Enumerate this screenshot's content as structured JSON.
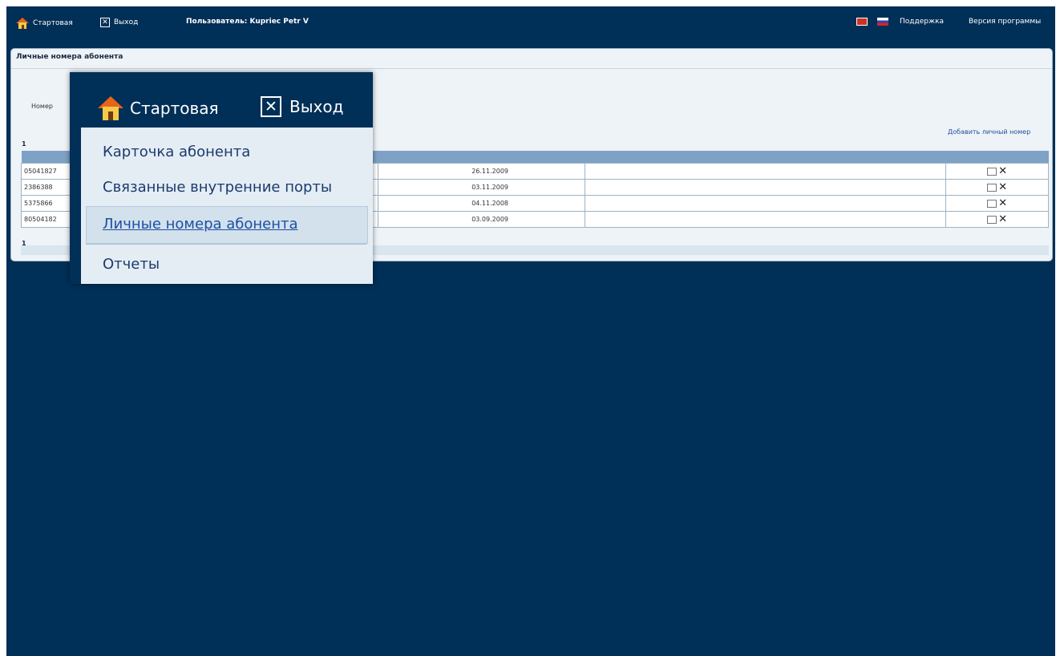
{
  "topbar": {
    "home_label": "Стартовая",
    "exit_label": "Выход",
    "user_label": "Пользователь: Kupriec Petr V",
    "support_label": "Поддержка",
    "version_label": "Версия программы"
  },
  "panel": {
    "title": "Личные номера абонента",
    "number_label": "Номер",
    "add_link": "Добавить личный номер",
    "pager_top": "1",
    "pager_bottom": "1"
  },
  "table": {
    "rows": [
      {
        "number": "05041827",
        "date": "26.11.2009"
      },
      {
        "number": "2386388",
        "date": "03.11.2009"
      },
      {
        "number": "5375866",
        "date": "04.11.2008"
      },
      {
        "number": "80504182",
        "date": "03.09.2009"
      }
    ]
  },
  "zoom": {
    "home_label": "Стартовая",
    "exit_label": "Выход",
    "menu": [
      "Карточка абонента",
      "Связанные внутренние порты",
      "Личные номера абонента",
      "Отчеты"
    ]
  },
  "colors": {
    "background": "#002f57",
    "panel": "#eef3f7",
    "header_row": "#7ea2c6",
    "link": "#1f4f9a"
  }
}
